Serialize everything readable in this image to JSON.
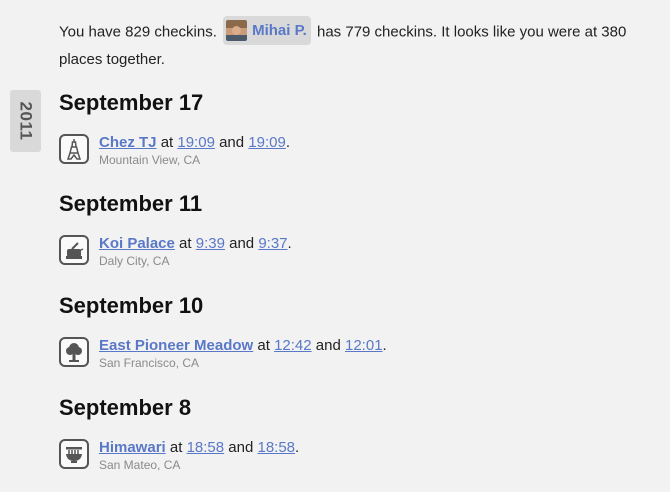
{
  "summary": {
    "you_prefix": "You have 829 checkins.",
    "friend_name": "Mihai P.",
    "rest": "has 779 checkins. It looks like you were at 380 places together."
  },
  "year": "2011",
  "days": [
    {
      "date": "September 17",
      "venue": "Chez TJ",
      "connector_1": "at",
      "time_1": "19:09",
      "connector_2": "and",
      "time_2": "19:09",
      "end": ".",
      "location": "Mountain View, CA",
      "icon": "eiffel-tower-icon"
    },
    {
      "date": "September 11",
      "venue": "Koi Palace",
      "connector_1": "at",
      "time_1": "9:39",
      "connector_2": "and",
      "time_2": "9:37",
      "end": ".",
      "location": "Daly City, CA",
      "icon": "teapot-icon"
    },
    {
      "date": "September 10",
      "venue": "East Pioneer Meadow",
      "connector_1": "at",
      "time_1": "12:42",
      "connector_2": "and",
      "time_2": "12:01",
      "end": ".",
      "location": "San Francisco, CA",
      "icon": "tree-icon"
    },
    {
      "date": "September 8",
      "venue": "Himawari",
      "connector_1": "at",
      "time_1": "18:58",
      "connector_2": "and",
      "time_2": "18:58",
      "end": ".",
      "location": "San Mateo, CA",
      "icon": "noodle-bowl-icon"
    }
  ]
}
